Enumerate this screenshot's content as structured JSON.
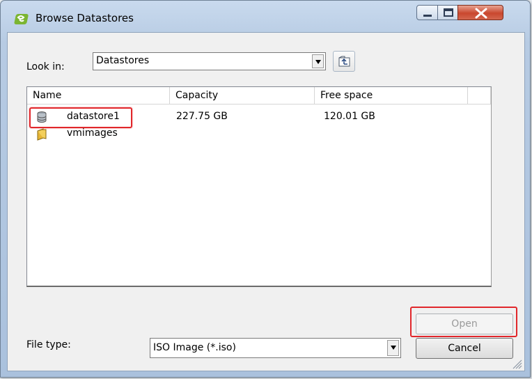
{
  "window": {
    "title": "Browse Datastores",
    "icons": {
      "app": "vsphere-app-icon",
      "minimize": "minimize-icon",
      "maximize": "maximize-icon",
      "close": "close-icon"
    }
  },
  "lookin": {
    "label": "Look in:",
    "value": "Datastores",
    "up_icon": "up-folder-icon"
  },
  "list": {
    "columns": [
      "Name",
      "Capacity",
      "Free space",
      ""
    ],
    "rows": [
      {
        "name": "datastore1",
        "capacity": "227.75 GB",
        "free": "120.01 GB",
        "icon": "database-icon"
      },
      {
        "name": "vmimages",
        "capacity": "",
        "free": "",
        "icon": "folder-icon"
      }
    ]
  },
  "filetype": {
    "label": "File type:",
    "value": "ISO Image (*.iso)"
  },
  "buttons": {
    "open": "Open",
    "cancel": "Cancel"
  },
  "colors": {
    "highlight": "#e1272b",
    "title_bar": "#c9daee",
    "close_button": "#c9472e"
  }
}
